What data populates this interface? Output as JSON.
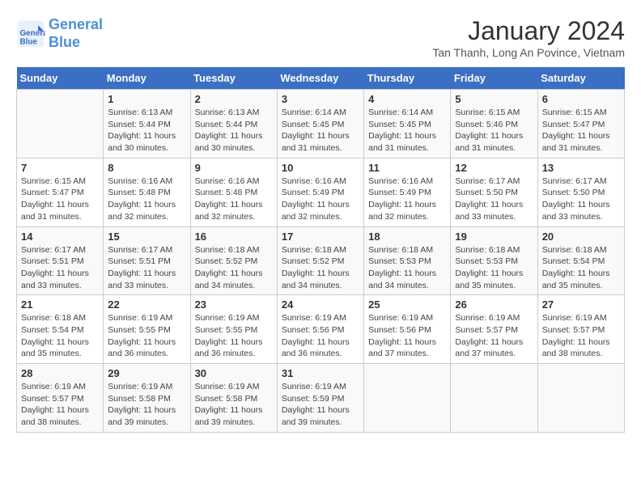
{
  "logo": {
    "line1": "General",
    "line2": "Blue"
  },
  "title": "January 2024",
  "subtitle": "Tan Thanh, Long An Povince, Vietnam",
  "days_of_week": [
    "Sunday",
    "Monday",
    "Tuesday",
    "Wednesday",
    "Thursday",
    "Friday",
    "Saturday"
  ],
  "weeks": [
    [
      {
        "day": null,
        "info": null
      },
      {
        "day": "1",
        "info": "Sunrise: 6:13 AM\nSunset: 5:44 PM\nDaylight: 11 hours and 30 minutes."
      },
      {
        "day": "2",
        "info": "Sunrise: 6:13 AM\nSunset: 5:44 PM\nDaylight: 11 hours and 30 minutes."
      },
      {
        "day": "3",
        "info": "Sunrise: 6:14 AM\nSunset: 5:45 PM\nDaylight: 11 hours and 31 minutes."
      },
      {
        "day": "4",
        "info": "Sunrise: 6:14 AM\nSunset: 5:45 PM\nDaylight: 11 hours and 31 minutes."
      },
      {
        "day": "5",
        "info": "Sunrise: 6:15 AM\nSunset: 5:46 PM\nDaylight: 11 hours and 31 minutes."
      },
      {
        "day": "6",
        "info": "Sunrise: 6:15 AM\nSunset: 5:47 PM\nDaylight: 11 hours and 31 minutes."
      }
    ],
    [
      {
        "day": "7",
        "info": "Sunrise: 6:15 AM\nSunset: 5:47 PM\nDaylight: 11 hours and 31 minutes."
      },
      {
        "day": "8",
        "info": "Sunrise: 6:16 AM\nSunset: 5:48 PM\nDaylight: 11 hours and 32 minutes."
      },
      {
        "day": "9",
        "info": "Sunrise: 6:16 AM\nSunset: 5:48 PM\nDaylight: 11 hours and 32 minutes."
      },
      {
        "day": "10",
        "info": "Sunrise: 6:16 AM\nSunset: 5:49 PM\nDaylight: 11 hours and 32 minutes."
      },
      {
        "day": "11",
        "info": "Sunrise: 6:16 AM\nSunset: 5:49 PM\nDaylight: 11 hours and 32 minutes."
      },
      {
        "day": "12",
        "info": "Sunrise: 6:17 AM\nSunset: 5:50 PM\nDaylight: 11 hours and 33 minutes."
      },
      {
        "day": "13",
        "info": "Sunrise: 6:17 AM\nSunset: 5:50 PM\nDaylight: 11 hours and 33 minutes."
      }
    ],
    [
      {
        "day": "14",
        "info": "Sunrise: 6:17 AM\nSunset: 5:51 PM\nDaylight: 11 hours and 33 minutes."
      },
      {
        "day": "15",
        "info": "Sunrise: 6:17 AM\nSunset: 5:51 PM\nDaylight: 11 hours and 33 minutes."
      },
      {
        "day": "16",
        "info": "Sunrise: 6:18 AM\nSunset: 5:52 PM\nDaylight: 11 hours and 34 minutes."
      },
      {
        "day": "17",
        "info": "Sunrise: 6:18 AM\nSunset: 5:52 PM\nDaylight: 11 hours and 34 minutes."
      },
      {
        "day": "18",
        "info": "Sunrise: 6:18 AM\nSunset: 5:53 PM\nDaylight: 11 hours and 34 minutes."
      },
      {
        "day": "19",
        "info": "Sunrise: 6:18 AM\nSunset: 5:53 PM\nDaylight: 11 hours and 35 minutes."
      },
      {
        "day": "20",
        "info": "Sunrise: 6:18 AM\nSunset: 5:54 PM\nDaylight: 11 hours and 35 minutes."
      }
    ],
    [
      {
        "day": "21",
        "info": "Sunrise: 6:18 AM\nSunset: 5:54 PM\nDaylight: 11 hours and 35 minutes."
      },
      {
        "day": "22",
        "info": "Sunrise: 6:19 AM\nSunset: 5:55 PM\nDaylight: 11 hours and 36 minutes."
      },
      {
        "day": "23",
        "info": "Sunrise: 6:19 AM\nSunset: 5:55 PM\nDaylight: 11 hours and 36 minutes."
      },
      {
        "day": "24",
        "info": "Sunrise: 6:19 AM\nSunset: 5:56 PM\nDaylight: 11 hours and 36 minutes."
      },
      {
        "day": "25",
        "info": "Sunrise: 6:19 AM\nSunset: 5:56 PM\nDaylight: 11 hours and 37 minutes."
      },
      {
        "day": "26",
        "info": "Sunrise: 6:19 AM\nSunset: 5:57 PM\nDaylight: 11 hours and 37 minutes."
      },
      {
        "day": "27",
        "info": "Sunrise: 6:19 AM\nSunset: 5:57 PM\nDaylight: 11 hours and 38 minutes."
      }
    ],
    [
      {
        "day": "28",
        "info": "Sunrise: 6:19 AM\nSunset: 5:57 PM\nDaylight: 11 hours and 38 minutes."
      },
      {
        "day": "29",
        "info": "Sunrise: 6:19 AM\nSunset: 5:58 PM\nDaylight: 11 hours and 39 minutes."
      },
      {
        "day": "30",
        "info": "Sunrise: 6:19 AM\nSunset: 5:58 PM\nDaylight: 11 hours and 39 minutes."
      },
      {
        "day": "31",
        "info": "Sunrise: 6:19 AM\nSunset: 5:59 PM\nDaylight: 11 hours and 39 minutes."
      },
      {
        "day": null,
        "info": null
      },
      {
        "day": null,
        "info": null
      },
      {
        "day": null,
        "info": null
      }
    ]
  ]
}
